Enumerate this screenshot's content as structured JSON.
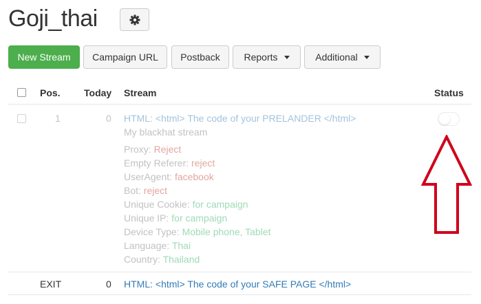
{
  "page": {
    "title": "Goji_thai"
  },
  "toolbar": {
    "new_stream": "New Stream",
    "campaign_url": "Campaign URL",
    "postback": "Postback",
    "reports": "Reports",
    "additional": "Additional"
  },
  "table": {
    "headers": {
      "pos": "Pos.",
      "today": "Today",
      "stream": "Stream",
      "status": "Status"
    },
    "rows": [
      {
        "pos": "1",
        "today": "0",
        "stream_title": "HTML: <html> The code of your PRELANDER </html>",
        "stream_name": "My blackhat stream",
        "filters": [
          {
            "label": "Proxy:",
            "value": "Reject",
            "color": "red"
          },
          {
            "label": "Empty Referer:",
            "value": "reject",
            "color": "red"
          },
          {
            "label": "UserAgent:",
            "value": "facebook",
            "color": "red"
          },
          {
            "label": "Bot:",
            "value": "reject",
            "color": "red"
          },
          {
            "label": "Unique Cookie:",
            "value": "for campaign",
            "color": "green"
          },
          {
            "label": "Unique IP:",
            "value": "for campaign",
            "color": "green"
          },
          {
            "label": "Device Type:",
            "value": "Mobile phone, Tablet",
            "color": "green"
          },
          {
            "label": "Language:",
            "value": "Thai",
            "color": "green"
          },
          {
            "label": "Country:",
            "value": "Thailand",
            "color": "green"
          }
        ],
        "status_on": false
      },
      {
        "pos": "EXIT",
        "today": "0",
        "stream_title": "HTML: <html> The code of your SAFE PAGE </html>"
      }
    ]
  },
  "colors": {
    "primary_button": "#4cae4c",
    "link_blue": "#337ab7",
    "filter_red": "#c0392b",
    "filter_green": "#27ae60",
    "arrow_red": "#d0021b"
  }
}
